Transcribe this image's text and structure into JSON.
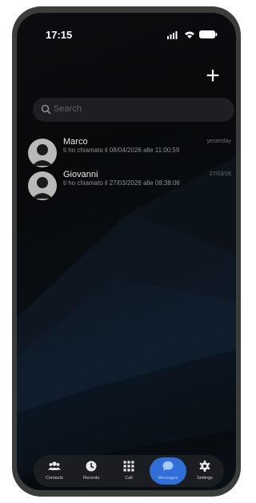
{
  "status_bar": {
    "time": "17:15"
  },
  "header": {
    "add_label": "+"
  },
  "search": {
    "placeholder": "Search"
  },
  "conversations": [
    {
      "name": "Marco",
      "message": "ti ho chiamato il 08/04/2026 alle 11:00:59",
      "date": "yesterday"
    },
    {
      "name": "Giovanni",
      "message": "ti ho chiamato il 27/03/2026 alle 08:38:06",
      "date": "27/03/26"
    }
  ],
  "tabs": [
    {
      "label": "Contacts",
      "icon": "people-icon"
    },
    {
      "label": "Recents",
      "icon": "clock-icon"
    },
    {
      "label": "Call",
      "icon": "dialpad-icon"
    },
    {
      "label": "Messages",
      "icon": "chat-bubble-icon"
    },
    {
      "label": "Settings",
      "icon": "gear-icon"
    }
  ],
  "active_tab": "Messages",
  "colors": {
    "accent": "#2f6fd6",
    "background": "#07090b",
    "bezel": "#3a3d3a"
  }
}
